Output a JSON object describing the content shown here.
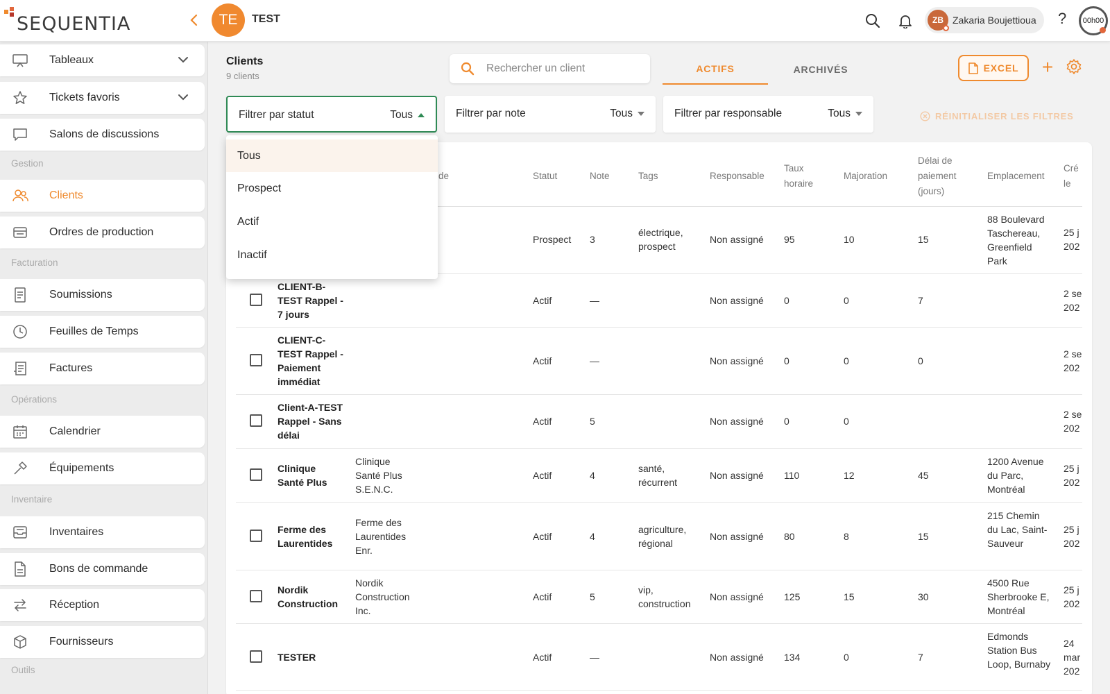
{
  "app": {
    "logo_text": "SEQUENTIA",
    "logo_colors": [
      "#ef8a2e",
      "#e2673c",
      "#b7372a"
    ],
    "accent": "#ef8a2e"
  },
  "header": {
    "workspace_initials": "TE",
    "workspace_name": "TEST",
    "user_initials": "ZB",
    "user_name": "Zakaria Boujettioua",
    "help_label": "?",
    "timer": "00h00"
  },
  "sidebar": {
    "items": [
      {
        "label": "Tableaux",
        "icon": "dashboard-icon"
      },
      {
        "label": "Tickets favoris",
        "icon": "star-icon"
      },
      {
        "label": "Salons de discussions",
        "icon": "chat-icon"
      },
      {
        "label": "Clients",
        "icon": "users-icon"
      },
      {
        "label": "Ordres de production",
        "icon": "production-icon"
      },
      {
        "label": "Soumissions",
        "icon": "document-icon"
      },
      {
        "label": "Feuilles de Temps",
        "icon": "clock-icon"
      },
      {
        "label": "Factures",
        "icon": "invoice-icon"
      },
      {
        "label": "Calendrier",
        "icon": "calendar-icon"
      },
      {
        "label": "Équipements",
        "icon": "tool-icon"
      },
      {
        "label": "Inventaires",
        "icon": "inbox-icon"
      },
      {
        "label": "Bons de commande",
        "icon": "file-icon"
      },
      {
        "label": "Réception",
        "icon": "transfer-icon"
      },
      {
        "label": "Fournisseurs",
        "icon": "box-icon"
      }
    ],
    "sections": [
      "Gestion",
      "Facturation",
      "Opérations",
      "Inventaire",
      "Outils"
    ]
  },
  "main": {
    "title": "Clients",
    "count": "9 clients",
    "search_placeholder": "Rechercher un client",
    "tabs": [
      "ACTIFS",
      "ARCHIVÉS"
    ],
    "excel_label": "EXCEL",
    "plus_label": "+",
    "filters": [
      {
        "label": "Filtrer par statut",
        "value": "Tous"
      },
      {
        "label": "Filtrer par note",
        "value": "Tous"
      },
      {
        "label": "Filtrer par responsable",
        "value": "Tous"
      }
    ],
    "reset_label": "RÉINITIALISER LES FILTRES",
    "status_options": [
      "Tous",
      "Prospect",
      "Actif",
      "Inactif"
    ],
    "columns": [
      "de",
      "Statut",
      "Note",
      "Tags",
      "Responsable",
      "Taux horaire",
      "Majoration",
      "Délai de paiement (jours)",
      "Emplacement",
      "Cré le"
    ],
    "rows": [
      {
        "name": "",
        "company": "",
        "status": "Prospect",
        "note": "3",
        "tags": "électrique, prospect",
        "owner": "Non assigné",
        "rate": "95",
        "markup": "10",
        "delay": "15",
        "location": "88 Boulevard Taschereau, Greenfield Park",
        "created": "25 j 202"
      },
      {
        "name": "CLIENT-B-TEST Rappel - 7 jours",
        "company": "",
        "status": "Actif",
        "note": "—",
        "tags": "",
        "owner": "Non assigné",
        "rate": "0",
        "markup": "0",
        "delay": "7",
        "location": "",
        "created": "2 se 202"
      },
      {
        "name": "CLIENT-C-TEST Rappel - Paiement immédiat",
        "company": "",
        "status": "Actif",
        "note": "—",
        "tags": "",
        "owner": "Non assigné",
        "rate": "0",
        "markup": "0",
        "delay": "0",
        "location": "",
        "created": "2 se 202"
      },
      {
        "name": "Client-A-TEST Rappel - Sans délai",
        "company": "",
        "status": "Actif",
        "note": "5",
        "tags": "",
        "owner": "Non assigné",
        "rate": "0",
        "markup": "0",
        "delay": "",
        "location": "",
        "created": "2 se 202"
      },
      {
        "name": "Clinique Santé Plus",
        "company": "Clinique Santé Plus S.E.N.C.",
        "status": "Actif",
        "note": "4",
        "tags": "santé, récurrent",
        "owner": "Non assigné",
        "rate": "110",
        "markup": "12",
        "delay": "45",
        "location": "1200 Avenue du Parc, Montréal",
        "created": "25 j 202"
      },
      {
        "name": "Ferme des Laurentides",
        "company": "Ferme des Laurentides Enr.",
        "status": "Actif",
        "note": "4",
        "tags": "agriculture, régional",
        "owner": "Non assigné",
        "rate": "80",
        "markup": "8",
        "delay": "15",
        "location": "215 Chemin du Lac, Saint-Sauveur",
        "created": "25 j 202"
      },
      {
        "name": "Nordik Construction",
        "company": "Nordik Construction Inc.",
        "status": "Actif",
        "note": "5",
        "tags": "vip, construction",
        "owner": "Non assigné",
        "rate": "125",
        "markup": "15",
        "delay": "30",
        "location": "4500 Rue Sherbrooke E, Montréal",
        "created": "25 j 202"
      },
      {
        "name": "TESTER",
        "company": "",
        "status": "Actif",
        "note": "—",
        "tags": "",
        "owner": "Non assigné",
        "rate": "134",
        "markup": "0",
        "delay": "7",
        "location": "Edmonds Station Bus Loop, Burnaby",
        "created": "24 mar 202"
      }
    ]
  }
}
